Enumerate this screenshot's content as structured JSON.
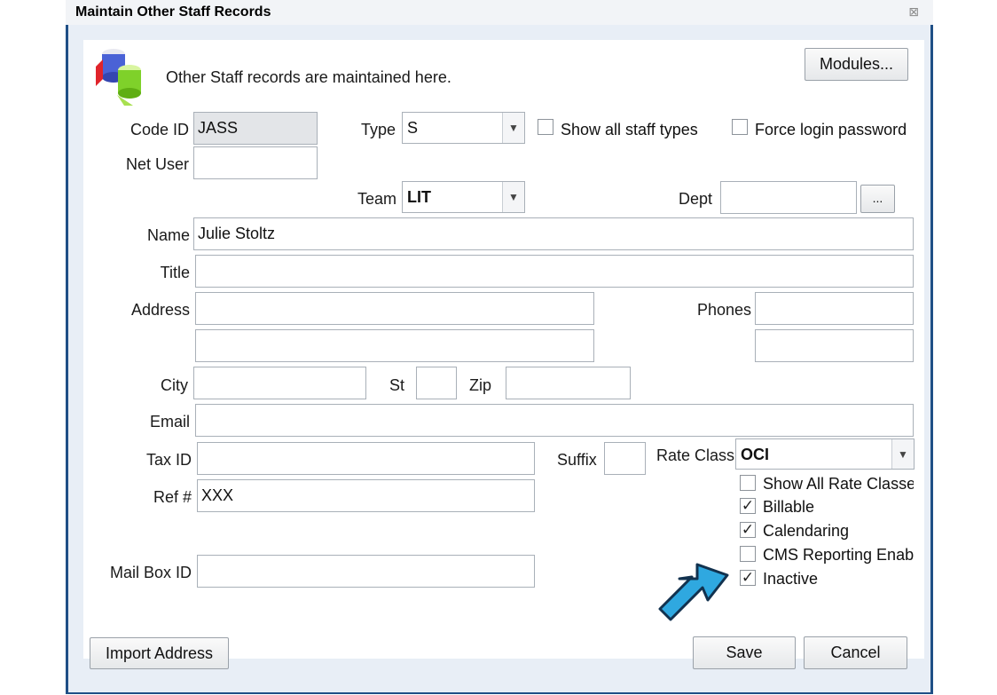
{
  "window": {
    "title": "Maintain Other Staff Records",
    "close_glyph": "⊠"
  },
  "header": {
    "description": "Other Staff records are maintained here.",
    "modules_button": "Modules..."
  },
  "fields": {
    "code_id": {
      "label": "Code ID",
      "value": "JASS"
    },
    "type": {
      "label": "Type",
      "value": "S"
    },
    "show_all_staff_types": {
      "label": "Show all staff types",
      "checked": false
    },
    "force_login_password": {
      "label": "Force login password",
      "checked": false
    },
    "net_user": {
      "label": "Net User",
      "value": ""
    },
    "team": {
      "label": "Team",
      "value": "LIT"
    },
    "dept": {
      "label": "Dept",
      "value": "",
      "browse": "..."
    },
    "name": {
      "label": "Name",
      "value": "Julie Stoltz"
    },
    "title": {
      "label": "Title",
      "value": ""
    },
    "address": {
      "label": "Address",
      "line1": "",
      "line2": ""
    },
    "phones": {
      "label": "Phones",
      "phone1": "",
      "phone2": ""
    },
    "city": {
      "label": "City",
      "value": ""
    },
    "st": {
      "label": "St",
      "value": ""
    },
    "zip": {
      "label": "Zip",
      "value": ""
    },
    "email": {
      "label": "Email",
      "value": ""
    },
    "tax_id": {
      "label": "Tax ID",
      "value": ""
    },
    "suffix": {
      "label": "Suffix",
      "value": ""
    },
    "rate_class": {
      "label": "Rate Class",
      "value": "OCI"
    },
    "ref": {
      "label": "Ref #",
      "value": "XXX"
    },
    "mail_box_id": {
      "label": "Mail Box ID",
      "value": ""
    }
  },
  "options": [
    {
      "label": "Show All Rate Classe",
      "checked": false,
      "mark": ""
    },
    {
      "label": "Billable",
      "checked": true,
      "mark": "✓"
    },
    {
      "label": "Calendaring",
      "checked": true,
      "mark": "✓"
    },
    {
      "label": "CMS Reporting Enab",
      "checked": false,
      "mark": ""
    },
    {
      "label": "Inactive",
      "checked": true,
      "mark": "✓"
    }
  ],
  "footer": {
    "import_address": "Import Address",
    "save": "Save",
    "cancel": "Cancel"
  },
  "colors": {
    "window_border": "#1f4f86",
    "pointer_arrow": "#2fa8e0"
  },
  "icons": {
    "logo": "database-icon",
    "pointer": "arrow-pointer-icon",
    "dropdown": "chevron-down-icon"
  }
}
